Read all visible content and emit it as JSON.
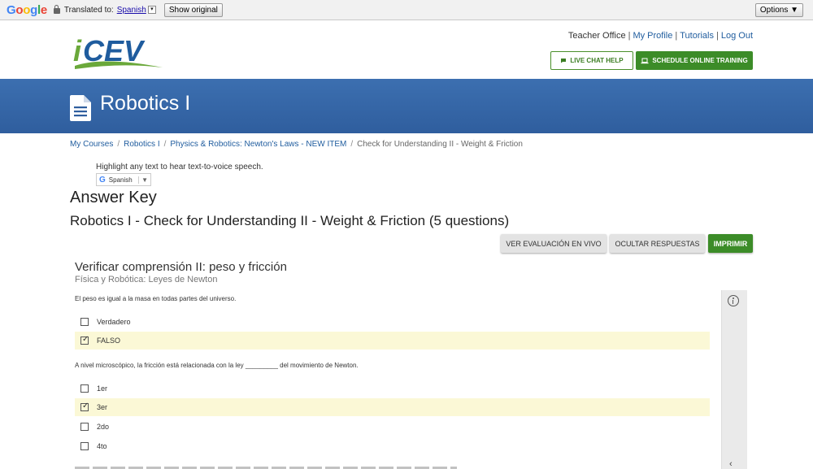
{
  "translate_bar": {
    "logo_text": "Google",
    "translated_to_label": "Translated to:",
    "language": "Spanish",
    "dropdown_arrow": "▾",
    "show_original": "Show original",
    "options": "Options ▼"
  },
  "header": {
    "links": [
      "Teacher Office",
      "My Profile",
      "Tutorials",
      "Log Out"
    ],
    "live_chat": "LIVE CHAT HELP",
    "schedule": "SCHEDULE ONLINE TRAINING",
    "logo_alt": "iCEV"
  },
  "banner": {
    "title": "Robotics I",
    "icon": "document-icon"
  },
  "breadcrumb": {
    "items": [
      "My Courses",
      "Robotics I",
      "Physics & Robotics: Newton's Laws - NEW ITEM"
    ],
    "current": "Check for Understanding II - Weight & Friction"
  },
  "tts": {
    "text": "Highlight any text to hear text-to-voice speech.",
    "language": "Spanish",
    "arrow": "▼"
  },
  "answer_key": "Answer Key",
  "quiz_heading": "Robotics I - Check for Understanding II - Weight & Friction (5 questions)",
  "actions": {
    "view_live": "VER EVALUACIÓN EN VIVO",
    "hide_answers": "OCULTAR RESPUESTAS",
    "print": "IMPRIMIR"
  },
  "quiz": {
    "title": "Verificar comprensión II: peso y fricción",
    "subtitle": "Física y Robótica: Leyes de Newton",
    "questions": [
      {
        "text": "El peso es igual a la masa en todas partes del universo.",
        "options": [
          {
            "label": "Verdadero",
            "selected": false
          },
          {
            "label": "FALSO",
            "selected": true
          }
        ]
      },
      {
        "text": "A nivel microscópico, la fricción está relacionada con la ley _________ del movimiento de Newton.",
        "options": [
          {
            "label": "1er",
            "selected": false
          },
          {
            "label": "3er",
            "selected": true
          },
          {
            "label": "2do",
            "selected": false
          },
          {
            "label": "4to",
            "selected": false
          }
        ]
      }
    ]
  },
  "colors": {
    "brand_blue": "#2f5e9e",
    "brand_green": "#3c8c28",
    "highlight": "#fbf8d6"
  },
  "check_glyph": "✓",
  "scroll_chevron": "‹"
}
